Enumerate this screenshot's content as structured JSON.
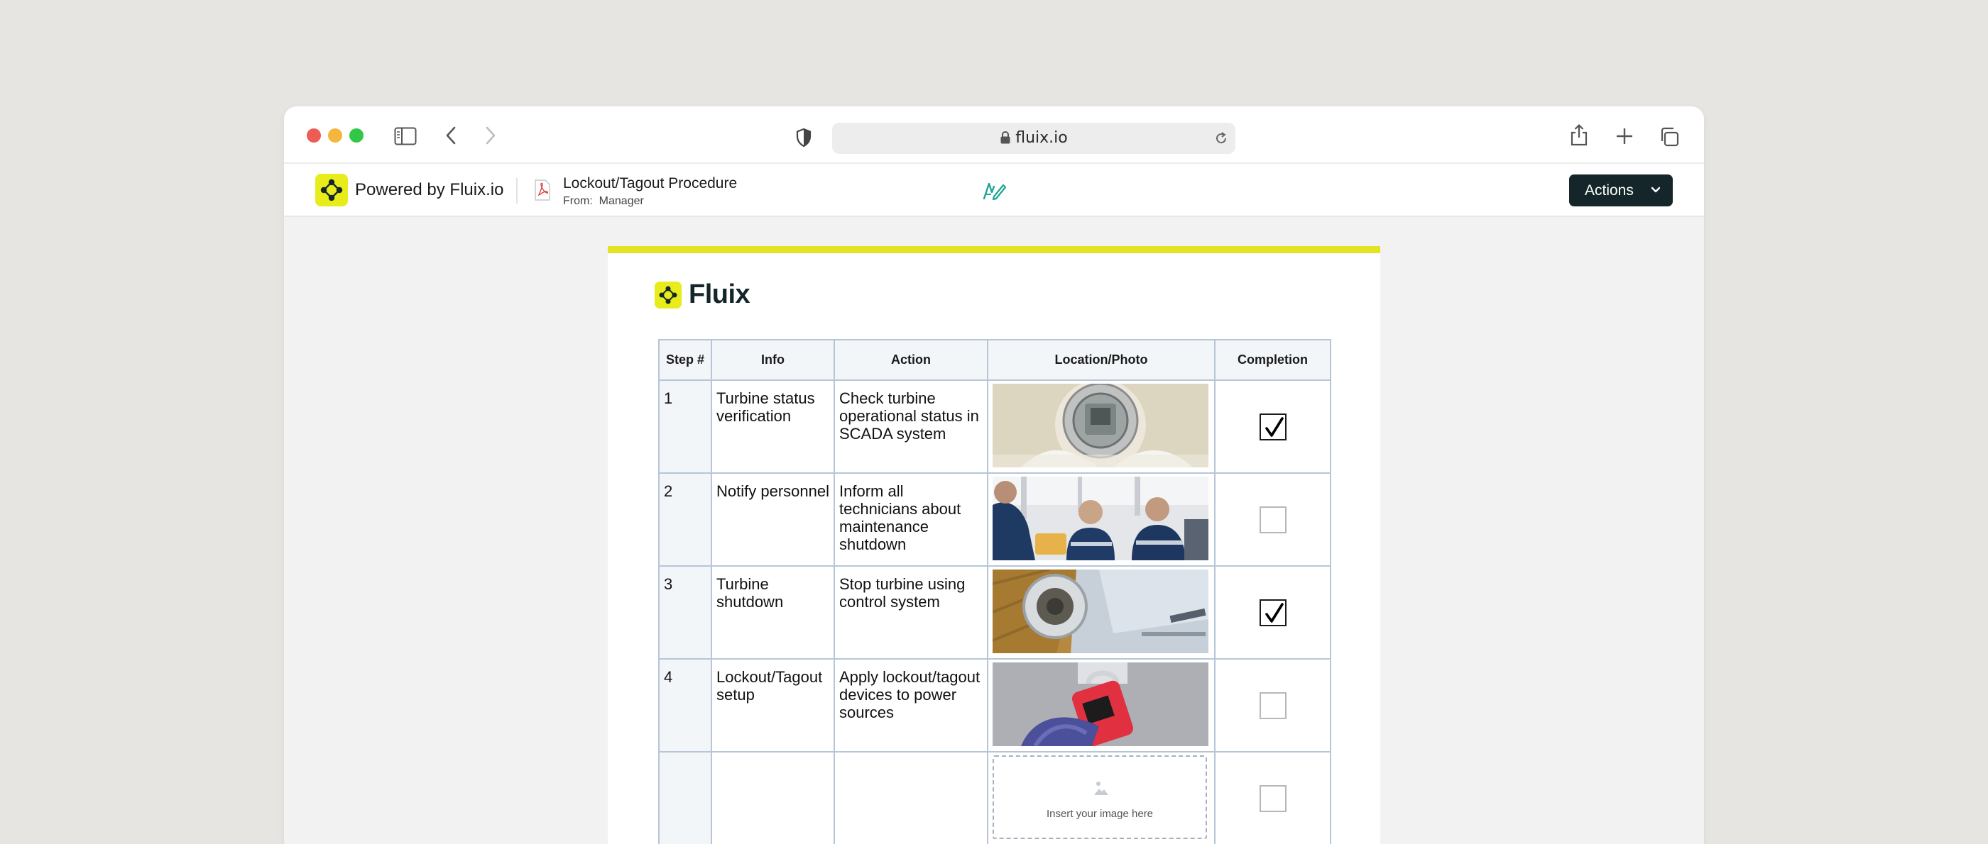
{
  "browser": {
    "url": "fluix.io",
    "icons": [
      "sidebar-icon",
      "back-icon",
      "forward-icon",
      "shield-icon",
      "lock-icon",
      "reload-icon",
      "share-icon",
      "new-tab-icon",
      "tabs-overview-icon"
    ]
  },
  "appbar": {
    "brand": "Powered by Fluix.io",
    "doc_title": "Lockout/Tagout Procedure",
    "from_label": "From:",
    "from_value": "Manager",
    "actions_label": "Actions"
  },
  "document": {
    "logo_text": "Fluix",
    "accent_color": "#e2e421",
    "columns": [
      "Step #",
      "Info",
      "Action",
      "Location/Photo",
      "Completion"
    ],
    "rows": [
      {
        "step": "1",
        "info": "Turbine status verification",
        "action": "Check turbine operational status in SCADA system",
        "photo": "turbine-hub-photo",
        "completed": true
      },
      {
        "step": "2",
        "info": "Notify personnel",
        "action": "Inform all technicians about maintenance shutdown",
        "photo": "technicians-photo",
        "completed": false
      },
      {
        "step": "3",
        "info": "Turbine shutdown",
        "action": "Stop turbine using control system",
        "photo": "turbine-nacelle-photo",
        "completed": true
      },
      {
        "step": "4",
        "info": "Lockout/Tagout setup",
        "action": "Apply lockout/tagout devices to power sources",
        "photo": "lockout-padlock-photo",
        "completed": false
      },
      {
        "step": "",
        "info": "",
        "action": "",
        "photo": "",
        "completed": false
      }
    ],
    "image_placeholder": "Insert your image here"
  },
  "colors": {
    "actions_button": "#15262b",
    "brand_yellow": "#e7ec1a",
    "table_border": "#b6c6d8"
  }
}
